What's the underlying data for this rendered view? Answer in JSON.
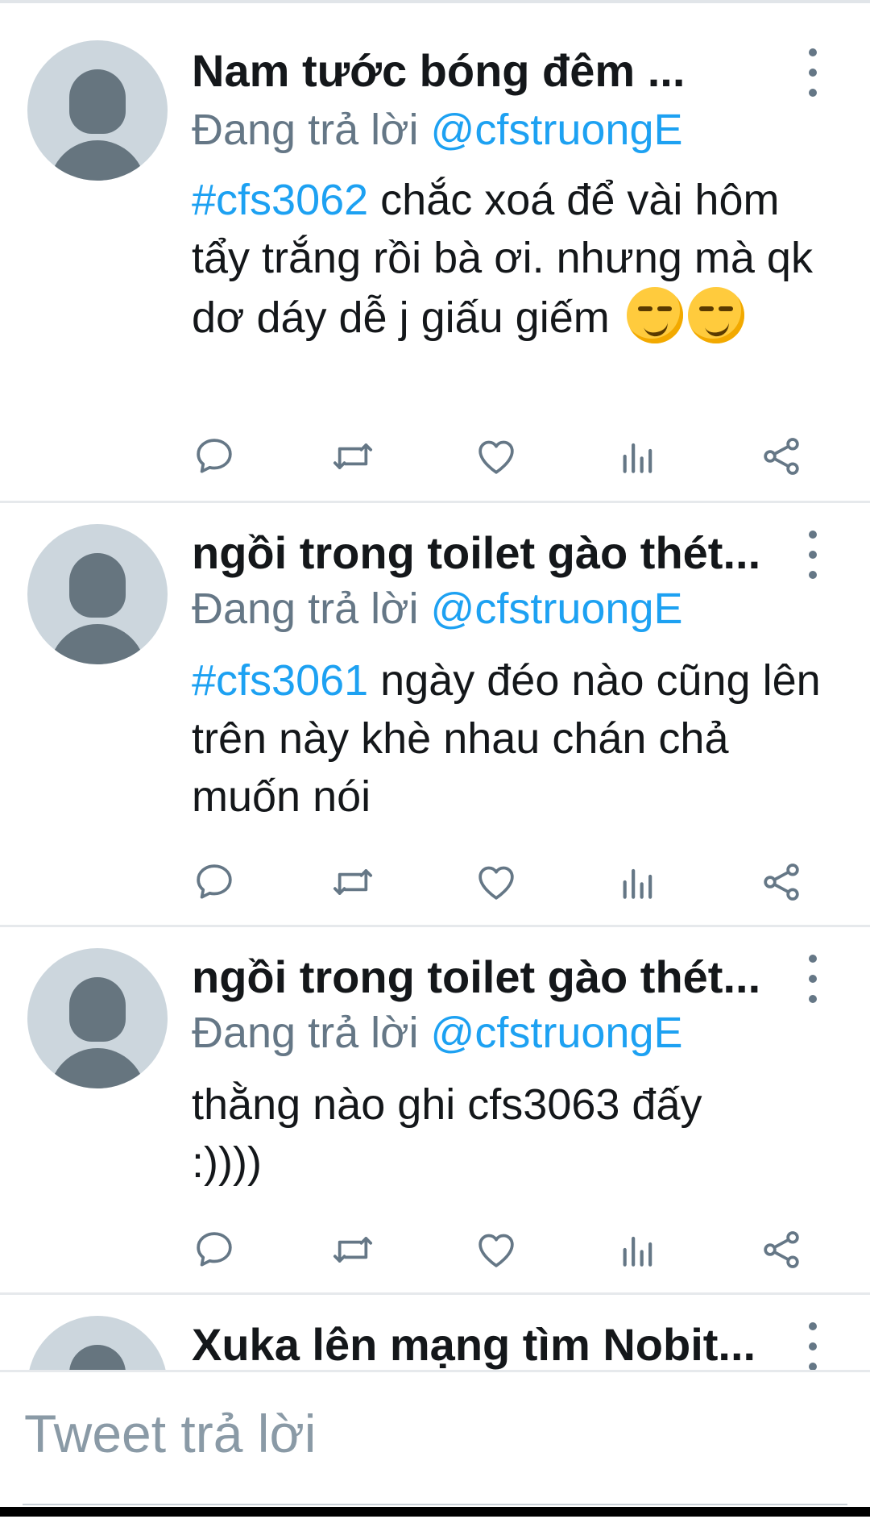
{
  "tweets": [
    {
      "name": "Nam tước bóng đêm ...",
      "reply_prefix": "Đang trả lời",
      "reply_handle": "@cfstruongE",
      "hashtag": "#cfs3062",
      "text": " chắc xoá để vài hôm tẩy trắng rồi bà ơi. nhưng mà qk dơ dáy dễ j giấu giếm ",
      "emoji": "smirking-face-emoji"
    },
    {
      "name": "ngồi trong toilet gào thét...",
      "reply_prefix": "Đang trả lời",
      "reply_handle": "@cfstruongE",
      "hashtag": "#cfs3061",
      "text": " ngày đéo nào cũng lên trên này khè nhau chán chả muốn nói"
    },
    {
      "name": "ngồi trong toilet gào thét...",
      "reply_prefix": "Đang trả lời",
      "reply_handle": "@cfstruongE",
      "hashtag": "",
      "text": "thằng nào ghi cfs3063 đấy :))))"
    },
    {
      "name": "Xuka lên mạng tìm Nobit..."
    }
  ],
  "action_icons": [
    "reply-icon",
    "retweet-icon",
    "like-icon",
    "analytics-icon",
    "share-icon"
  ],
  "composer": {
    "placeholder": "Tweet trả lời"
  },
  "colors": {
    "accent": "#1da1f2",
    "secondary_text": "#657786",
    "avatar_bg": "#ccd6dd"
  }
}
